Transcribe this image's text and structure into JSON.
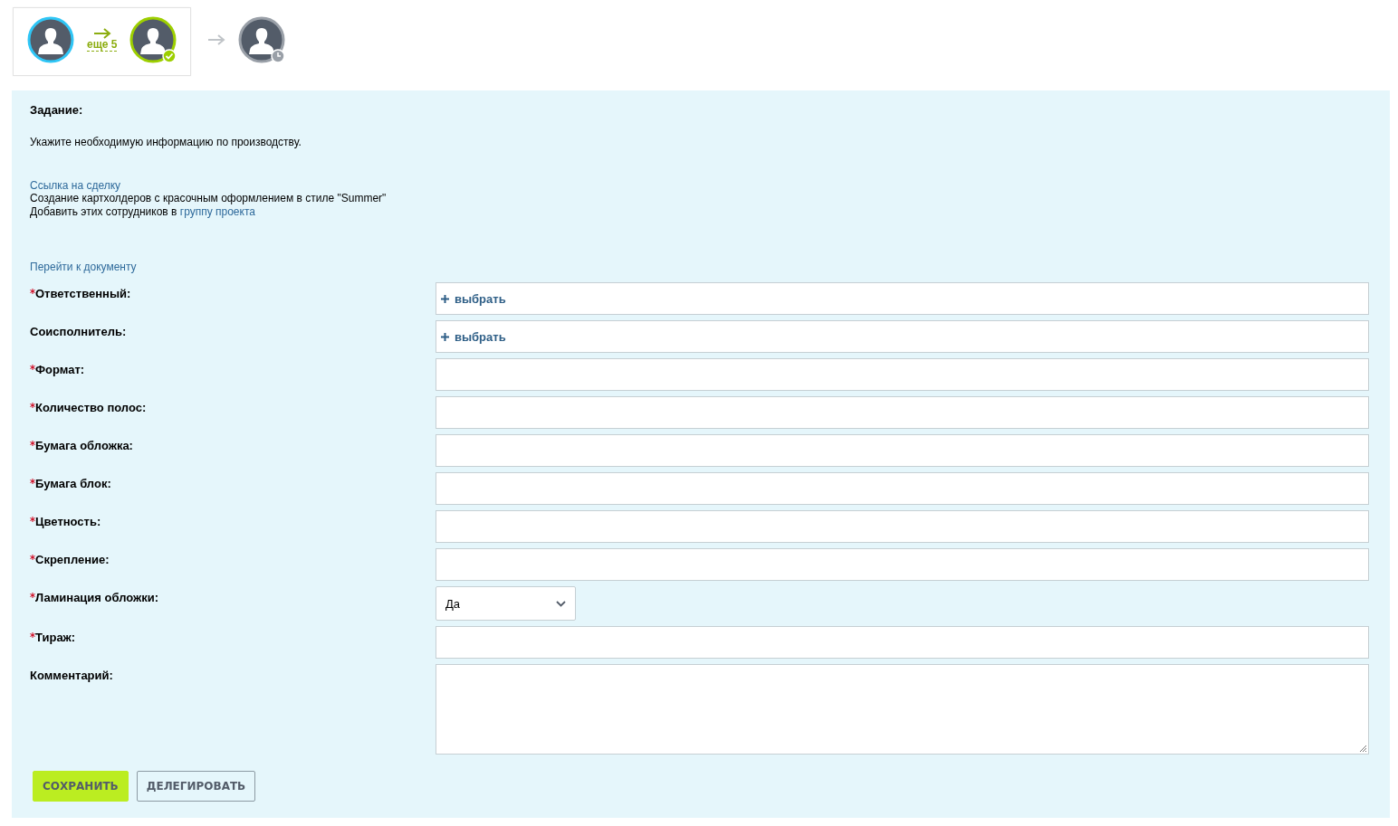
{
  "workflow": {
    "steps": [
      {
        "kind": "current"
      },
      {
        "kind": "done"
      }
    ],
    "more": "еще 5",
    "next": [
      {
        "kind": "pending"
      }
    ]
  },
  "task": {
    "heading": "Задание:",
    "instruction": "Укажите необходимую информацию по производству.",
    "deal_link": "Ссылка на сделку",
    "description": "Создание картхолдеров с красочным оформлением в стиле \"Summer\"",
    "add_text": "Добавить этих сотрудников в",
    "group_link": "группу проекта",
    "doc_link": "Перейти к документу"
  },
  "fields": [
    {
      "label": "Ответственный:",
      "required": true,
      "kind": "picker",
      "value": "выбрать"
    },
    {
      "label": "Соисполнитель:",
      "required": false,
      "kind": "picker",
      "value": "выбрать"
    },
    {
      "label": "Формат:",
      "required": true,
      "kind": "text"
    },
    {
      "label": "Количество полос:",
      "required": true,
      "kind": "text"
    },
    {
      "label": "Бумага обложка:",
      "required": true,
      "kind": "text"
    },
    {
      "label": "Бумага блок:",
      "required": true,
      "kind": "text"
    },
    {
      "label": "Цветность:",
      "required": true,
      "kind": "text"
    },
    {
      "label": "Скрепление:",
      "required": true,
      "kind": "text"
    },
    {
      "label": "Ламинация обложки:",
      "required": true,
      "kind": "select",
      "value": "Да"
    },
    {
      "label": "Тираж:",
      "required": true,
      "kind": "text"
    },
    {
      "label": "Комментарий:",
      "required": false,
      "kind": "textarea"
    }
  ],
  "buttons": [
    {
      "label": "СОХРАНИТЬ",
      "kind": "primary"
    },
    {
      "label": "ДЕЛЕГИРОВАТЬ",
      "kind": "secondary"
    }
  ]
}
